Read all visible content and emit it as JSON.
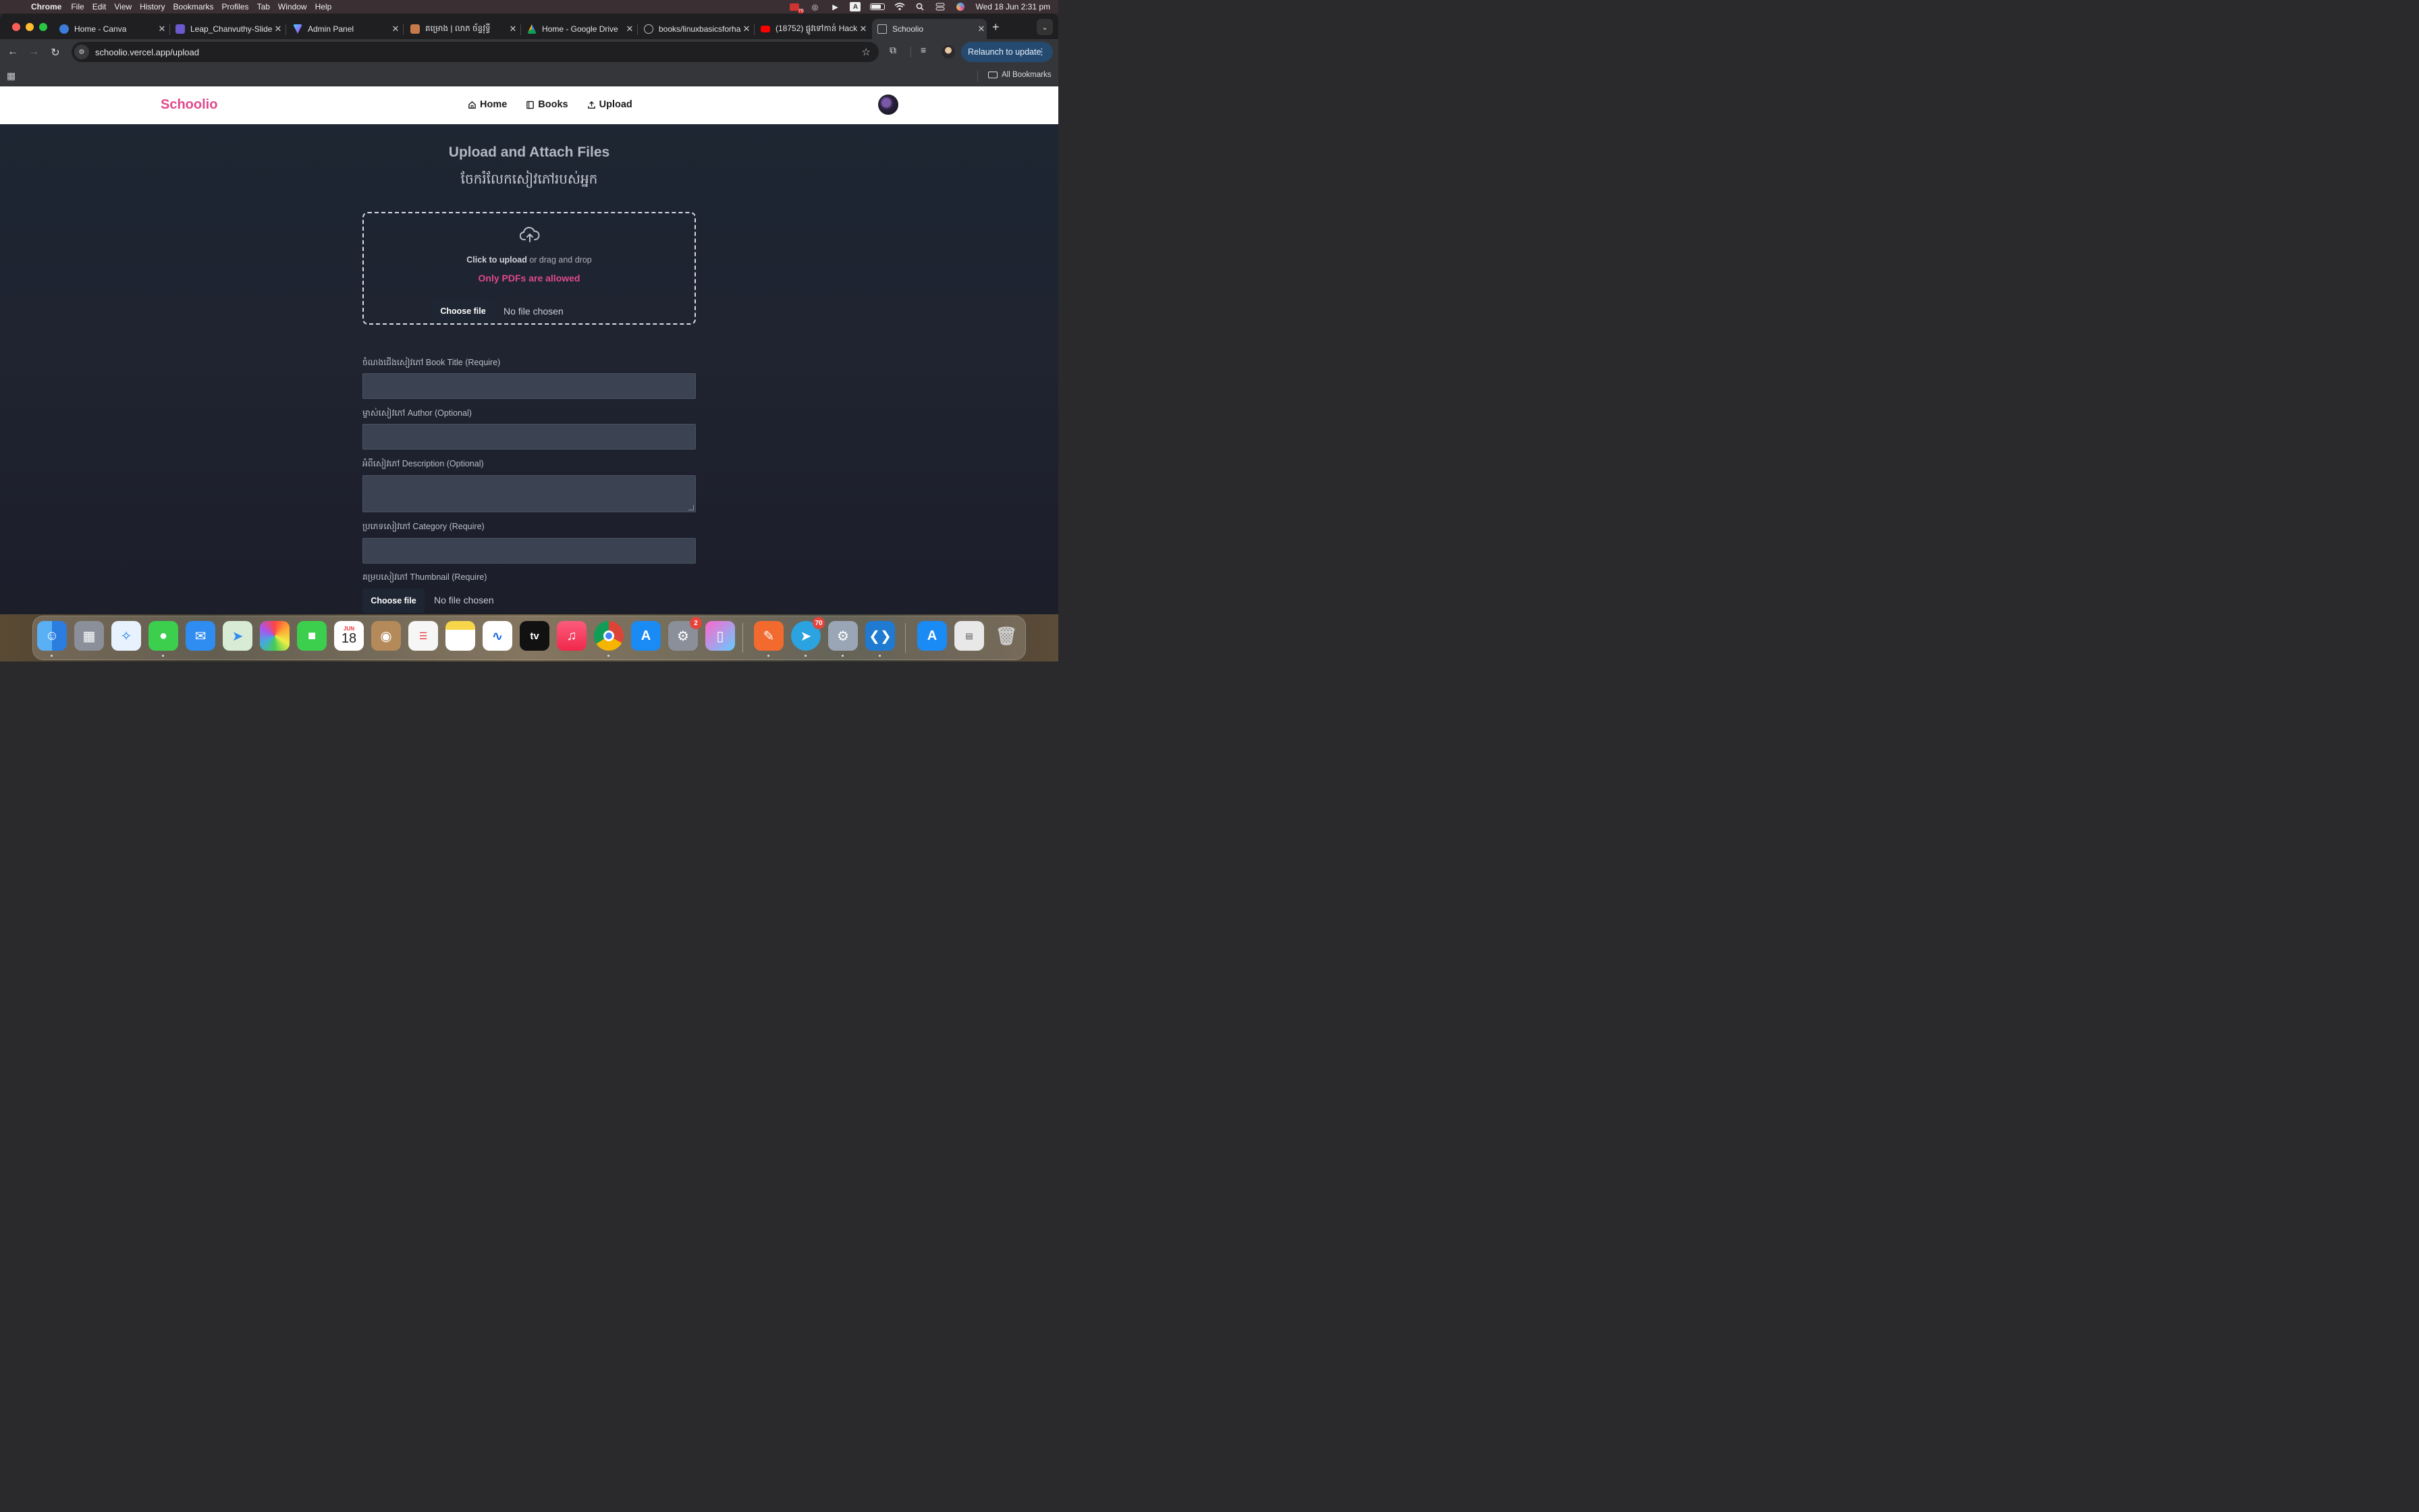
{
  "menubar": {
    "app": "Chrome",
    "items": [
      "File",
      "Edit",
      "View",
      "History",
      "Bookmarks",
      "Profiles",
      "Tab",
      "Window",
      "Help"
    ],
    "status_badge": "70",
    "input_source": "A",
    "datetime": "Wed 18 Jun  2:31 pm"
  },
  "tabs": [
    {
      "title": "Home - Canva",
      "icon": "canva-icon",
      "color": "#3b7dd8"
    },
    {
      "title": "Leap_Chanvuthy-Slide",
      "icon": "slides-icon",
      "color": "#6a5acd"
    },
    {
      "title": "Admin Panel",
      "icon": "vite-icon",
      "color": "#a77bf3"
    },
    {
      "title": "គម្រោង | លាភ ច័ន្ទវុទ្ធី",
      "icon": "profile-icon",
      "color": "#c47a4a"
    },
    {
      "title": "Home - Google Drive",
      "icon": "drive-icon",
      "color": "#f4b400"
    },
    {
      "title": "books/linuxbasicsforha",
      "icon": "globe-icon",
      "color": "#9aa0a6"
    },
    {
      "title": "(18752) ផ្លូវទៅកាន់ Hack",
      "icon": "youtube-icon",
      "color": "#ff0000"
    },
    {
      "title": "Schoolio",
      "icon": "schoolio-icon",
      "color": "#9aa0a6"
    }
  ],
  "omnibox": {
    "url": "schoolio.vercel.app/upload"
  },
  "relaunch_label": "Relaunch to update",
  "bookmarks": {
    "all_label": "All Bookmarks"
  },
  "site": {
    "logo": "Schoolio",
    "nav": [
      {
        "label": "Home",
        "icon": "home-icon"
      },
      {
        "label": "Books",
        "icon": "book-icon"
      },
      {
        "label": "Upload",
        "icon": "upload-icon"
      }
    ]
  },
  "upload": {
    "title": "Upload and Attach Files",
    "subtitle": "ចែករំលែកសៀវភៅរបស់អ្នក",
    "click_text": "Click to upload",
    "drag_text": " or drag and drop",
    "warning": "Only PDFs are allowed",
    "choose_file": "Choose file",
    "no_file": "No file chosen",
    "warning_color": "#e0498c"
  },
  "form": {
    "title_label": "ចំណងជើងសៀវភៅ Book Title (Require)",
    "author_label": "ម្ចាស់សៀវភៅ Author (Optional)",
    "description_label": "អំពីសៀវភៅ Description (Optional)",
    "category_label": "ប្រភេទសៀវភៅ Category (Require)",
    "thumbnail_label": "គម្របសៀវភៅ Thumbnail (Require)",
    "title_value": "",
    "author_value": "",
    "description_value": "",
    "category_value": "",
    "thumb_choose": "Choose file",
    "thumb_status": "No file chosen"
  },
  "dock": {
    "calendar_month": "JUN",
    "calendar_day": "18",
    "settings_badge": "2",
    "telegram_badge": "70",
    "tv_label": "tv"
  }
}
